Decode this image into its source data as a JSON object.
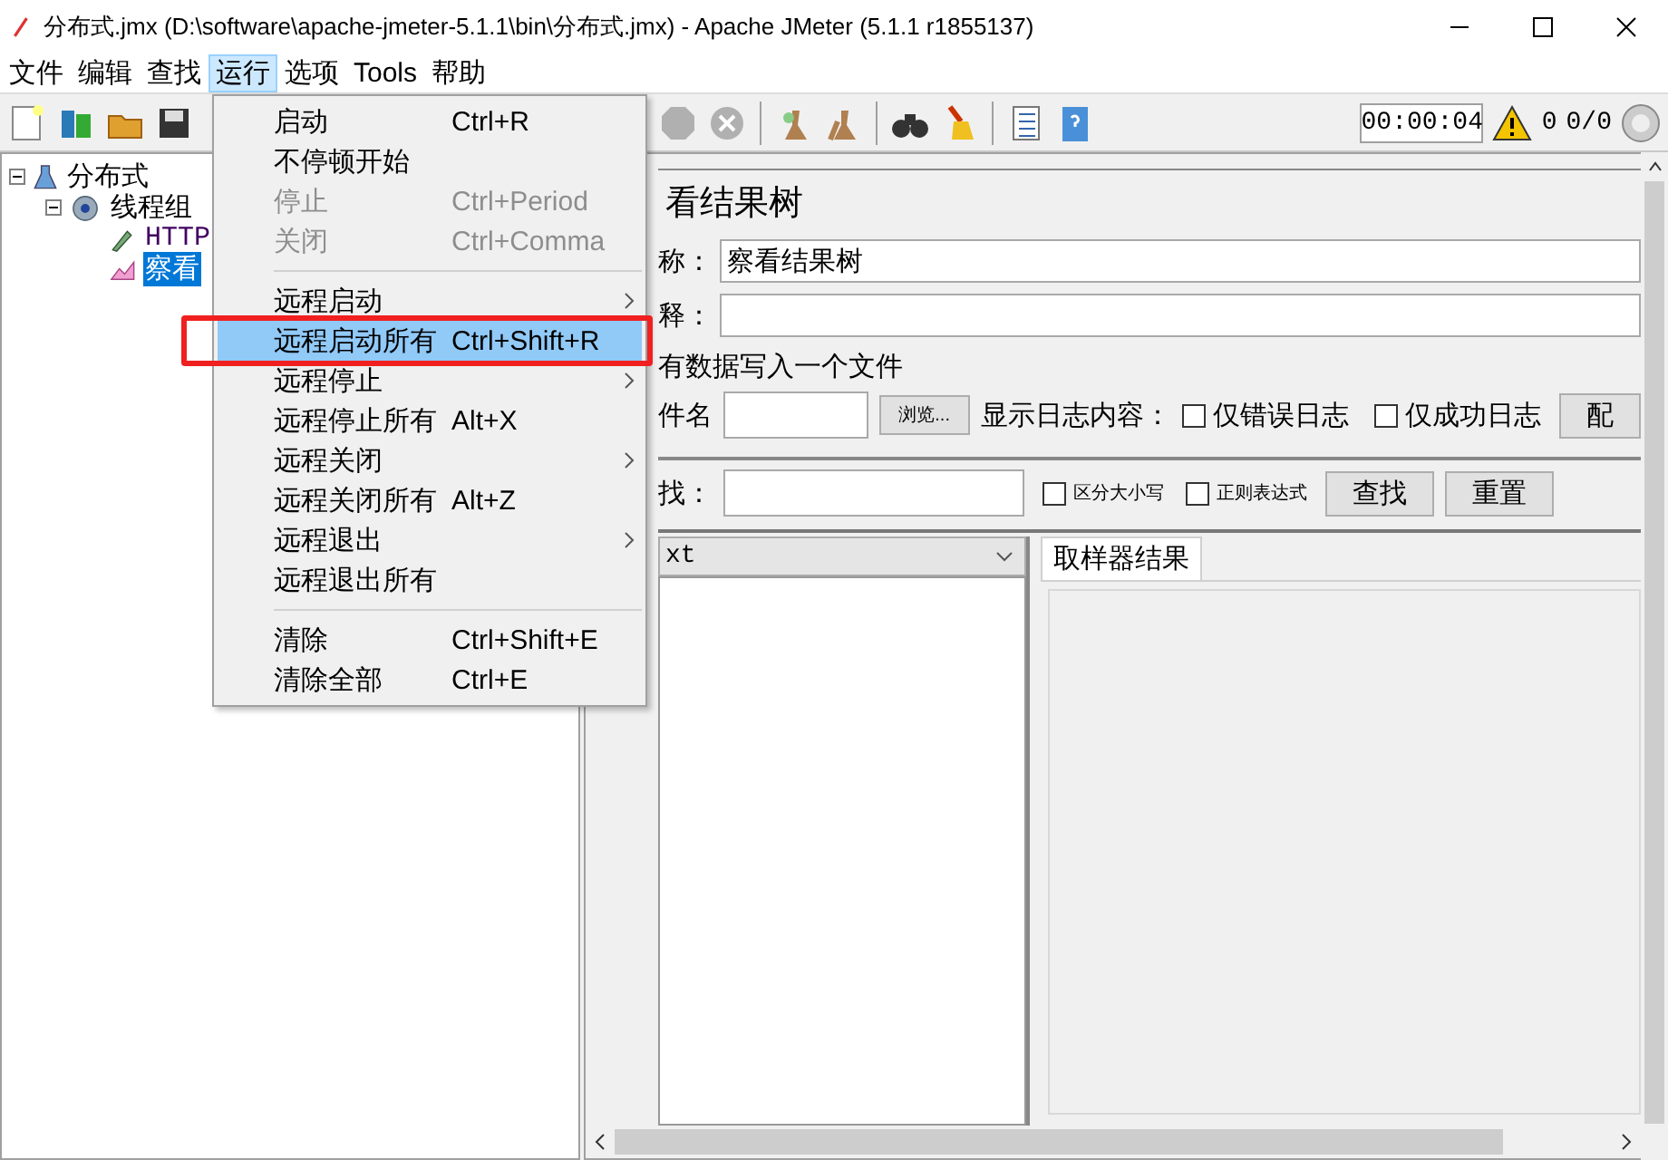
{
  "window": {
    "title": "分布式.jmx (D:\\software\\apache-jmeter-5.1.1\\bin\\分布式.jmx) - Apache JMeter (5.1.1 r1855137)"
  },
  "menubar": [
    {
      "label": "文件",
      "selected": false
    },
    {
      "label": "编辑",
      "selected": false
    },
    {
      "label": "查找",
      "selected": false
    },
    {
      "label": "运行",
      "selected": true
    },
    {
      "label": "选项",
      "selected": false
    },
    {
      "label": "Tools",
      "selected": false
    },
    {
      "label": "帮助",
      "selected": false
    }
  ],
  "toolbar": {
    "timer": "00:00:04",
    "warnings": "0",
    "threads": "0/0"
  },
  "tree": [
    {
      "label": "分布式",
      "expanded": true,
      "selected": false,
      "children": [
        {
          "label": "线程组",
          "expanded": true,
          "selected": false,
          "children": [
            {
              "label": "HTTP",
              "kind": "sampler",
              "selected": false
            },
            {
              "label": "察看",
              "kind": "listener",
              "selected": true
            }
          ]
        }
      ]
    }
  ],
  "menu": [
    {
      "kind": "item",
      "label": "启动",
      "shortcut": "Ctrl+R",
      "disabled": false,
      "submenu": false,
      "selected": false,
      "marked": false
    },
    {
      "kind": "item",
      "label": "不停顿开始",
      "disabled": false,
      "submenu": false,
      "selected": false,
      "marked": false
    },
    {
      "kind": "item",
      "label": "停止",
      "shortcut": "Ctrl+Period",
      "disabled": true,
      "submenu": false,
      "selected": false,
      "marked": false
    },
    {
      "kind": "item",
      "label": "关闭",
      "shortcut": "Ctrl+Comma",
      "disabled": true,
      "submenu": false,
      "selected": false,
      "marked": false
    },
    {
      "kind": "separator"
    },
    {
      "kind": "item",
      "label": "远程启动",
      "disabled": false,
      "submenu": true,
      "selected": false,
      "marked": false
    },
    {
      "kind": "item",
      "label": "远程启动所有",
      "shortcut": "Ctrl+Shift+R",
      "disabled": false,
      "submenu": false,
      "selected": true,
      "marked": true
    },
    {
      "kind": "item",
      "label": "远程停止",
      "disabled": false,
      "submenu": true,
      "selected": false,
      "marked": false
    },
    {
      "kind": "item",
      "label": "远程停止所有",
      "shortcut": "Alt+X",
      "disabled": false,
      "submenu": false,
      "selected": false,
      "marked": false
    },
    {
      "kind": "item",
      "label": "远程关闭",
      "disabled": false,
      "submenu": true,
      "selected": false,
      "marked": false
    },
    {
      "kind": "item",
      "label": "远程关闭所有",
      "shortcut": "Alt+Z",
      "disabled": false,
      "submenu": false,
      "selected": false,
      "marked": false
    },
    {
      "kind": "item",
      "label": "远程退出",
      "disabled": false,
      "submenu": true,
      "selected": false,
      "marked": false
    },
    {
      "kind": "item",
      "label": "远程退出所有",
      "disabled": false,
      "submenu": false,
      "selected": false,
      "marked": false
    },
    {
      "kind": "separator"
    },
    {
      "kind": "item",
      "label": "清除",
      "shortcut": "Ctrl+Shift+E",
      "disabled": false,
      "submenu": false,
      "selected": false,
      "marked": false
    },
    {
      "kind": "item",
      "label": "清除全部",
      "shortcut": "Ctrl+E",
      "disabled": false,
      "submenu": false,
      "selected": false,
      "marked": false
    }
  ],
  "panel": {
    "title": "看结果树",
    "name_label": "称：",
    "name_value": "察看结果树",
    "comment_label": "释：",
    "file_group": {
      "legend": "有数据写入一个文件",
      "file_label": "件名",
      "browse": "浏览...",
      "log_label": "显示日志内容：",
      "errors_only": {
        "label": "仅错误日志",
        "checked": false
      },
      "success_only": {
        "label": "仅成功日志",
        "checked": false
      },
      "configure": "配"
    },
    "search": {
      "label": "找：",
      "case_sensitive": {
        "label": "区分大小写",
        "checked": false
      },
      "regex": {
        "label": "正则表达式",
        "checked": false
      },
      "find": "查找",
      "reset": "重置"
    },
    "renderer": "xt",
    "tabs": [
      {
        "label": "取样器结果",
        "selected": true
      }
    ]
  }
}
